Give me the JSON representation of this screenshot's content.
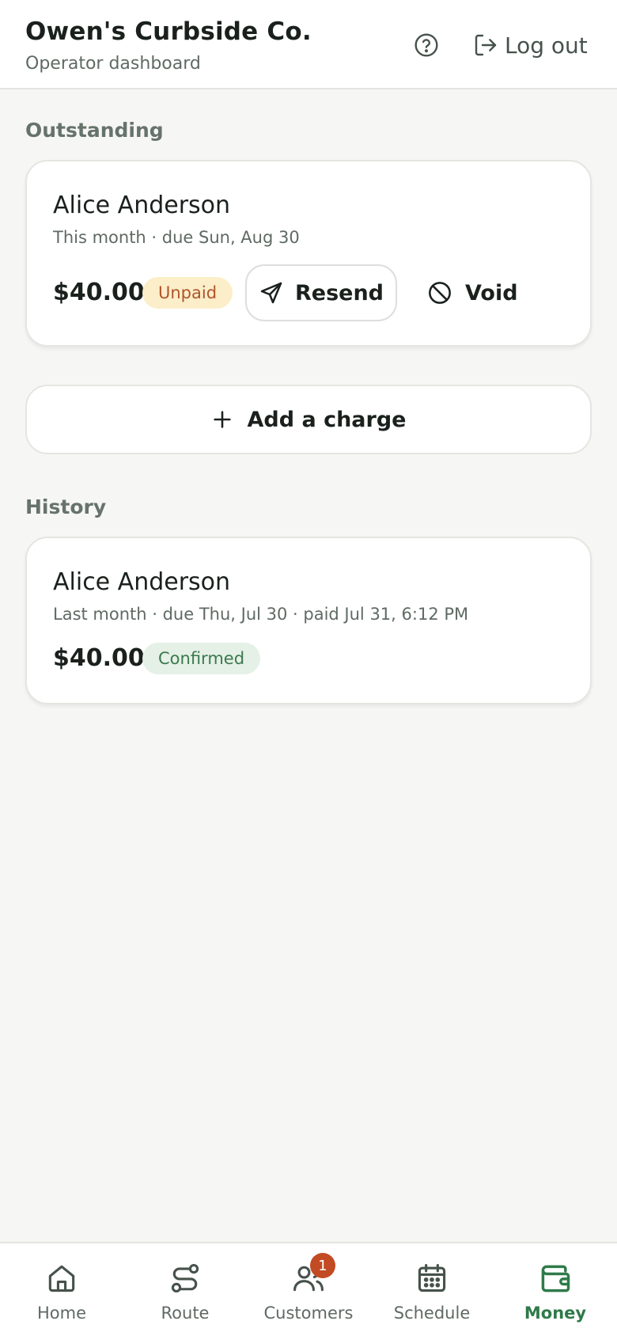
{
  "header": {
    "title": "Owen's Curbside Co.",
    "subtitle": "Operator dashboard",
    "logout_label": "Log out"
  },
  "outstanding": {
    "section_label": "Outstanding",
    "items": [
      {
        "customer": "Alice Anderson",
        "meta": "This month · due Sun, Aug 30",
        "amount": "$40.00",
        "status": "Unpaid",
        "resend_label": "Resend",
        "void_label": "Void"
      }
    ],
    "add_charge_label": "Add a charge"
  },
  "history": {
    "section_label": "History",
    "items": [
      {
        "customer": "Alice Anderson",
        "meta": "Last month · due Thu, Jul 30 · paid Jul 31, 6:12 PM",
        "amount": "$40.00",
        "status": "Confirmed"
      }
    ]
  },
  "nav": {
    "items": [
      {
        "label": "Home",
        "icon": "home-icon"
      },
      {
        "label": "Route",
        "icon": "route-icon"
      },
      {
        "label": "Customers",
        "icon": "users-icon",
        "badge": "1"
      },
      {
        "label": "Schedule",
        "icon": "calendar-icon"
      },
      {
        "label": "Money",
        "icon": "wallet-icon",
        "active": true
      }
    ]
  },
  "colors": {
    "accent": "#2f7a4a",
    "unpaid_bg": "#fbeec9",
    "unpaid_text": "#b0542c",
    "confirmed_bg": "#e5f0e7",
    "confirmed_text": "#3b7a4d",
    "badge": "#c24b24"
  }
}
